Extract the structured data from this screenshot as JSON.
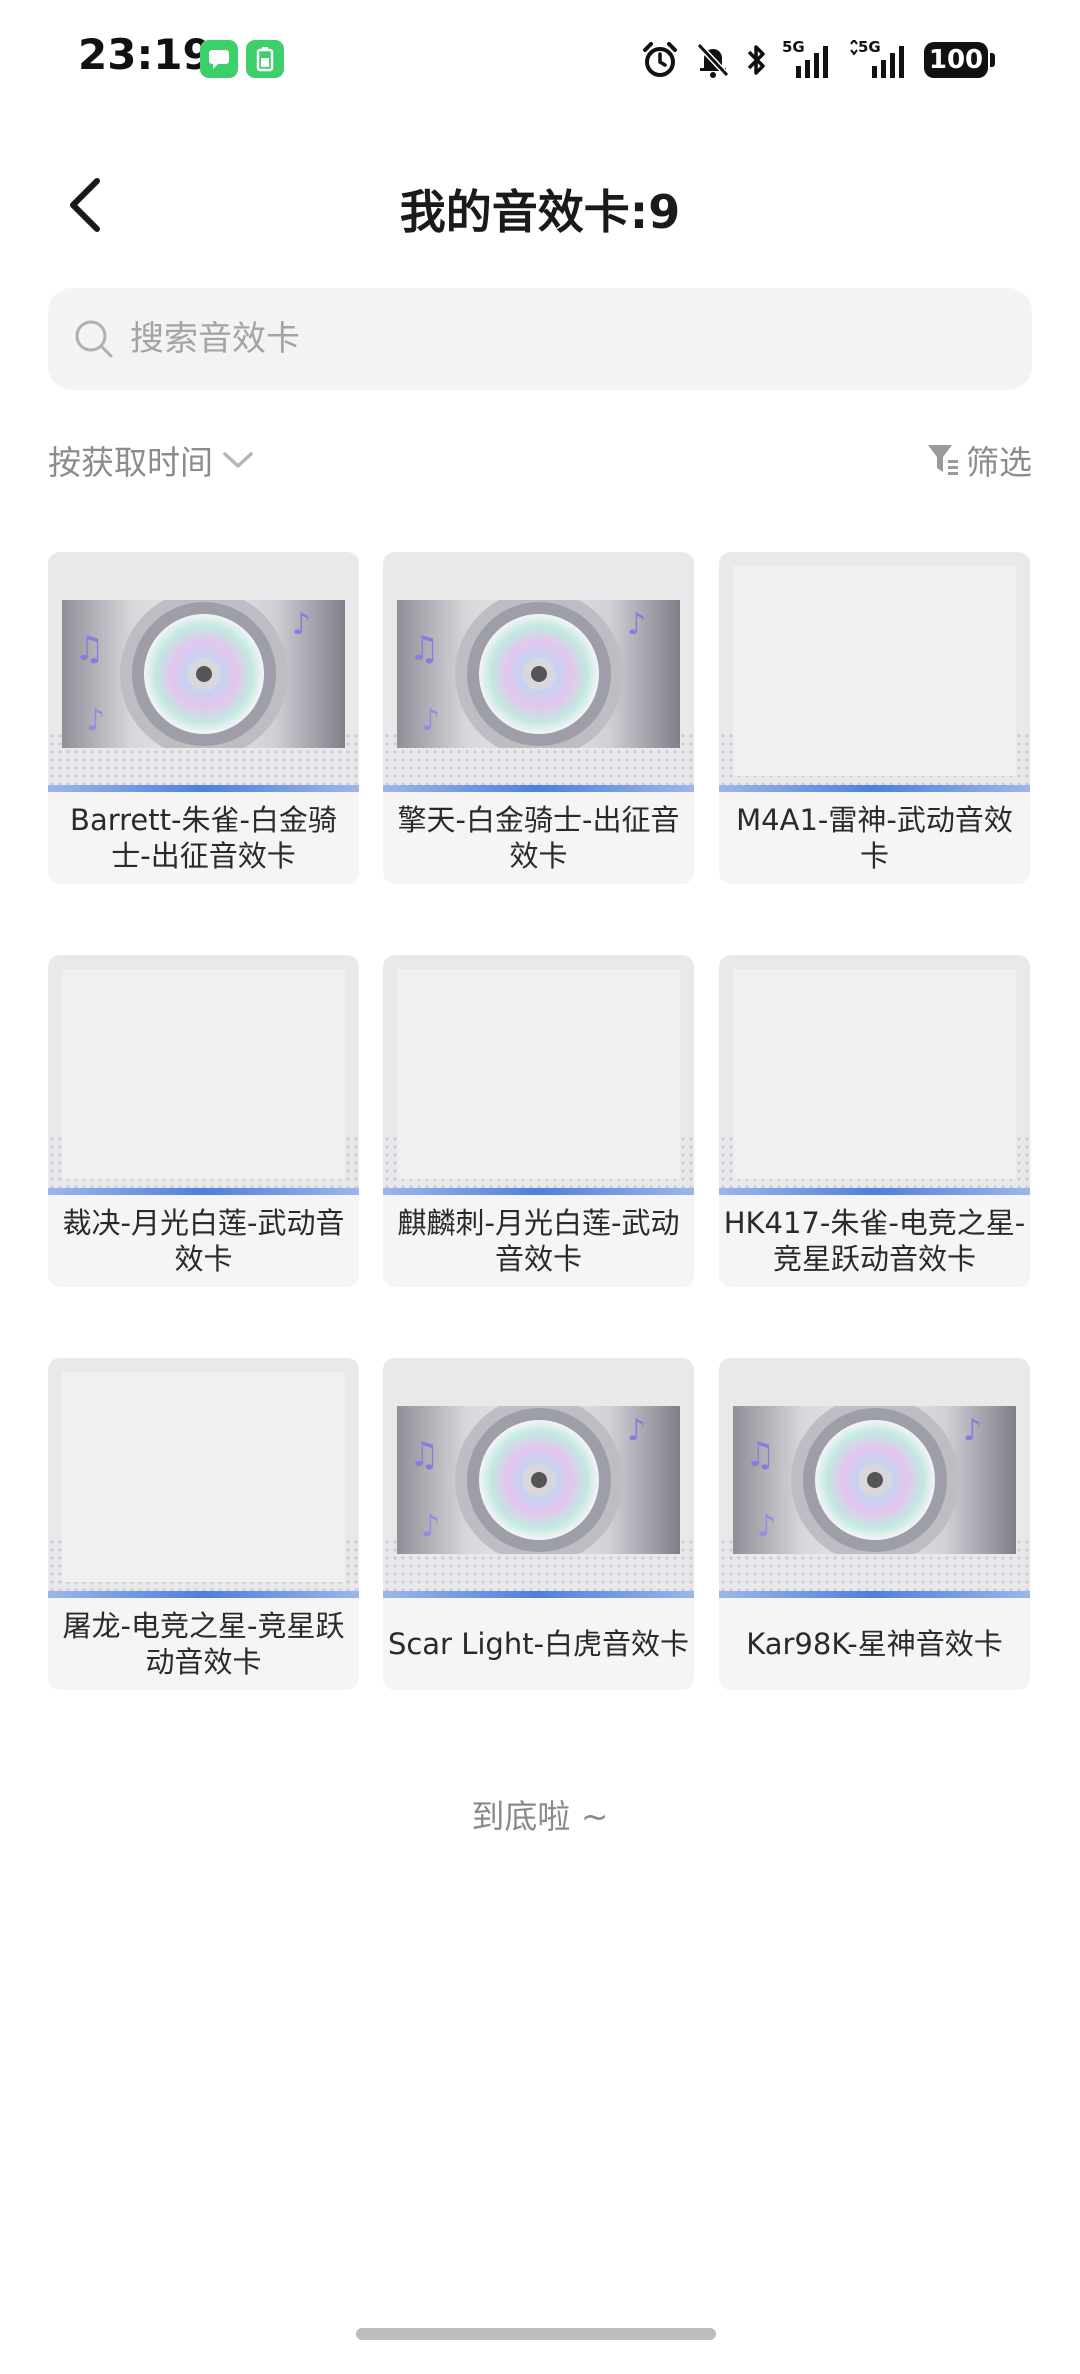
{
  "status_bar": {
    "time": "23:19",
    "battery": "100",
    "net1": "5G",
    "net2": "5G",
    "notif_colors": [
      "#3ccf6a",
      "#3ccf6a"
    ]
  },
  "header": {
    "title": "我的音效卡:9"
  },
  "search": {
    "placeholder": "搜索音效卡"
  },
  "sort": {
    "label": "按获取时间"
  },
  "filter": {
    "label": "筛选"
  },
  "cards": [
    {
      "name": "Barrett-朱雀-白金骑士-出征音效卡",
      "image": "disc"
    },
    {
      "name": "擎天-白金骑士-出征音效卡",
      "image": "disc"
    },
    {
      "name": "M4A1-雷神-武动音效卡",
      "image": "blank"
    },
    {
      "name": "裁决-月光白莲-武动音效卡",
      "image": "blank"
    },
    {
      "name": "麒麟刺-月光白莲-武动音效卡",
      "image": "blank"
    },
    {
      "name": "HK417-朱雀-电竞之星-竞星跃动音效卡",
      "image": "blank"
    },
    {
      "name": "屠龙-电竞之星-竞星跃动音效卡",
      "image": "blank"
    },
    {
      "name": "Scar Light-白虎音效卡",
      "image": "disc"
    },
    {
      "name": "Kar98K-星神音效卡",
      "image": "disc"
    }
  ],
  "footer": {
    "end_text": "到底啦 ~"
  },
  "colors": {
    "accent_blue": "#4f7fdc",
    "card_bg": "#f5f5f5",
    "search_bg": "#f3f3f3"
  }
}
